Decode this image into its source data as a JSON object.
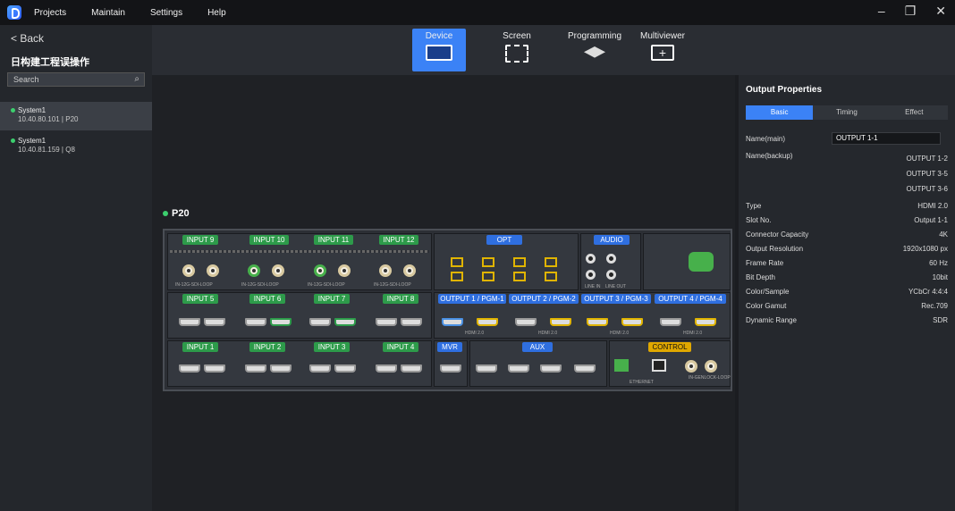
{
  "menu": [
    "Projects",
    "Maintain",
    "Settings",
    "Help"
  ],
  "window_controls": {
    "minimize": "–",
    "restore": "❐",
    "close": "✕"
  },
  "sidebar": {
    "back_label": "< Back",
    "project_name": "日构建工程误操作",
    "search_placeholder": "Search",
    "systems": [
      {
        "name": "System1",
        "detail": "10.40.80.101 | P20",
        "selected": true
      },
      {
        "name": "System1",
        "detail": "10.40.81.159 | Q8",
        "selected": false
      }
    ]
  },
  "top_tabs": [
    {
      "label": "Device",
      "icon": "device-icon",
      "active": true
    },
    {
      "label": "Screen",
      "icon": "screen-icon",
      "active": false
    },
    {
      "label": "Programming",
      "icon": "layers-icon",
      "active": false
    },
    {
      "label": "Multiviewer",
      "icon": "multiviewer-icon",
      "active": false
    }
  ],
  "device": {
    "model": "P20",
    "input_row_top": [
      "INPUT 9",
      "INPUT 10",
      "INPUT 11",
      "INPUT 12"
    ],
    "input_row_mid": [
      "INPUT 5",
      "INPUT 6",
      "INPUT 7",
      "INPUT 8"
    ],
    "input_row_bot": [
      "INPUT 1",
      "INPUT 2",
      "INPUT 3",
      "INPUT 4"
    ],
    "sdi_label": "IN-12G-SDI-LOOP",
    "opt_label": "OPT",
    "audio_label": "AUDIO",
    "line_in": "LINE IN",
    "line_out": "LINE OUT",
    "outputs": [
      "OUTPUT 1 / PGM-1",
      "OUTPUT 2 / PGM-2",
      "OUTPUT 3 / PGM-3",
      "OUTPUT 4 / PGM-4"
    ],
    "hdmi_label": "HDMI 2.0",
    "mvr_label": "MVR",
    "aux_label": "AUX",
    "control_label": "CONTROL",
    "ethernet_label": "ETHERNET",
    "genlock_label": "IN-GENLOCK-LOOP"
  },
  "properties": {
    "title": "Output Properties",
    "tabs": [
      "Basic",
      "Timing",
      "Effect"
    ],
    "name_main_label": "Name(main)",
    "name_main_value": "OUTPUT 1-1",
    "name_backup_label": "Name(backup)",
    "name_backup_values": [
      "OUTPUT 1-2",
      "OUTPUT 3-5",
      "OUTPUT 3-6"
    ],
    "rows": [
      {
        "label": "Type",
        "value": "HDMI 2.0"
      },
      {
        "label": "Slot No.",
        "value": "Output 1-1"
      },
      {
        "label": "Connector Capacity",
        "value": "4K"
      },
      {
        "label": "Output Resolution",
        "value": "1920x1080 px"
      },
      {
        "label": "Frame Rate",
        "value": "60 Hz"
      },
      {
        "label": "Bit Depth",
        "value": "10bit"
      },
      {
        "label": "Color/Sample",
        "value": "YCbCr 4:4:4"
      },
      {
        "label": "Color Gamut",
        "value": "Rec.709"
      },
      {
        "label": "Dynamic Range",
        "value": "SDR"
      }
    ]
  },
  "colors": {
    "accent": "#3b82f6",
    "green": "#2d9b4a",
    "yellow": "#e0a800"
  }
}
